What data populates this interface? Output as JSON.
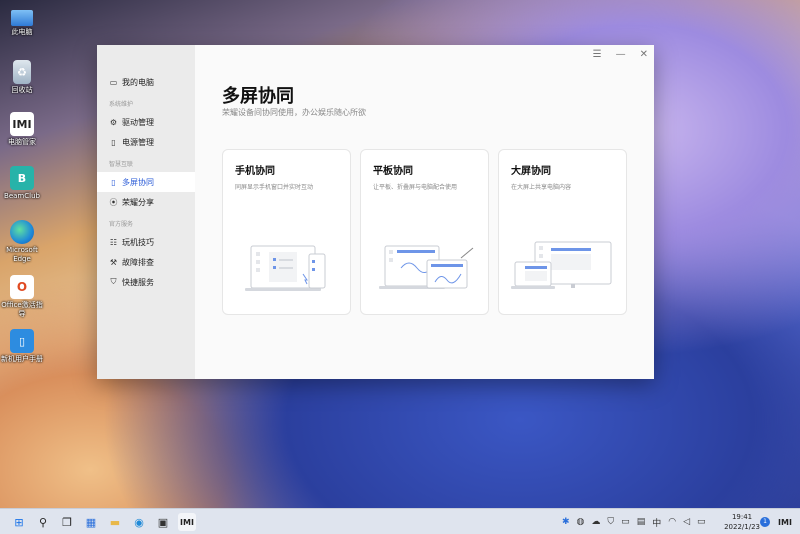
{
  "desktop": {
    "icons": [
      {
        "label": "此电脑",
        "icon": "monitor-icon",
        "color": "#3b7ad8"
      },
      {
        "label": "回收站",
        "icon": "recycle-bin-icon",
        "color": "#8aa2b8"
      },
      {
        "label": "电脑管家",
        "icon": "pc-manager-icon",
        "color": "#ffffff"
      },
      {
        "label": "BeamClub",
        "icon": "beamclub-icon",
        "color": "#2bb0a8"
      },
      {
        "label": "Microsoft Edge",
        "icon": "edge-icon",
        "color": "#1f8ad8"
      },
      {
        "label": "Office激活指导",
        "icon": "office-icon",
        "color": "#e04a22"
      },
      {
        "label": "新机用户手册",
        "icon": "manual-icon",
        "color": "#2d8ce0"
      }
    ]
  },
  "window": {
    "controls": {
      "menu": "☰",
      "minimize": "—",
      "close": "✕"
    },
    "sidebar": {
      "my_pc": "我的电脑",
      "group1": "系统维护",
      "driver": "驱动管理",
      "power": "电源管理",
      "group2": "智慧互联",
      "multiscreen": "多屏协同",
      "share": "荣耀分享",
      "group3": "官方服务",
      "tips": "玩机技巧",
      "troubleshoot": "故障排查",
      "service": "快捷服务"
    },
    "title": "多屏协同",
    "subtitle": "荣耀设备间协同使用，办公娱乐随心所欲",
    "cards": [
      {
        "title": "手机协同",
        "desc": "同屏显示手机窗口并实时互动"
      },
      {
        "title": "平板协同",
        "desc": "让平板、折叠屏与电脑配合使用"
      },
      {
        "title": "大屏协同",
        "desc": "在大屏上共享电脑内容"
      }
    ]
  },
  "taskbar": {
    "time": "19:41",
    "date": "2022/1/23",
    "notifications": "1",
    "ime": "中",
    "accent": "#2a5bd7"
  }
}
